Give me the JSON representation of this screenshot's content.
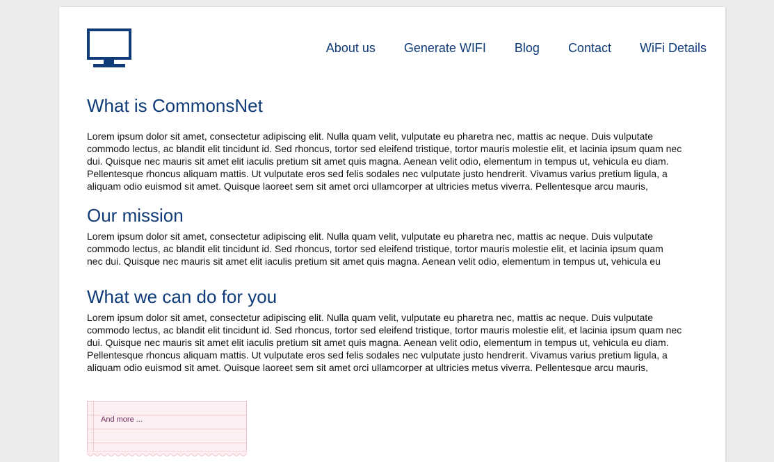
{
  "header": {
    "logo_icon": "monitor-icon",
    "nav": [
      {
        "label": "About us"
      },
      {
        "label": "Generate WIFI"
      },
      {
        "label": "Blog"
      },
      {
        "label": "Contact"
      },
      {
        "label": "WiFi Details"
      }
    ]
  },
  "sections": [
    {
      "title": "What is CommonsNet",
      "body": "Lorem ipsum dolor sit amet, consectetur adipiscing elit. Nulla quam velit, vulputate eu pharetra nec, mattis ac neque. Duis vulputate commodo lectus, ac blandit elit tincidunt id. Sed rhoncus, tortor sed eleifend tristique, tortor mauris molestie elit, et lacinia ipsum quam nec dui. Quisque nec mauris sit amet elit iaculis pretium sit amet quis magna. Aenean velit odio, elementum in tempus ut, vehicula eu diam. Pellentesque rhoncus aliquam mattis. Ut vulputate eros sed felis sodales nec vulputate justo hendrerit. Vivamus varius pretium ligula, a aliquam odio euismod sit amet. Quisque laoreet sem sit amet orci ullamcorper at ultricies metus viverra. Pellentesque arcu mauris,"
    },
    {
      "title": "Our mission",
      "body": "Lorem ipsum dolor sit amet, consectetur adipiscing elit. Nulla quam velit, vulputate eu pharetra nec, mattis ac neque. Duis vulputate commodo lectus, ac blandit elit tincidunt id. Sed rhoncus, tortor sed eleifend tristique, tortor mauris molestie elit, et lacinia ipsum quam nec dui. Quisque nec mauris sit amet elit iaculis pretium sit amet quis magna. Aenean velit odio, elementum in tempus ut, vehicula eu"
    },
    {
      "title": "What we can do for you",
      "body": "Lorem ipsum dolor sit amet, consectetur adipiscing elit. Nulla quam velit, vulputate eu pharetra nec, mattis ac neque. Duis vulputate commodo lectus, ac blandit elit tincidunt id. Sed rhoncus, tortor sed eleifend tristique, tortor mauris molestie elit, et lacinia ipsum quam nec dui. Quisque nec mauris sit amet elit iaculis pretium sit amet quis magna. Aenean velit odio, elementum in tempus ut, vehicula eu diam. Pellentesque rhoncus aliquam mattis. Ut vulputate eros sed felis sodales nec vulputate justo hendrerit. Vivamus varius pretium ligula, a aliquam odio euismod sit amet. Quisque laoreet sem sit amet orci ullamcorper at ultricies metus viverra. Pellentesque arcu mauris,"
    }
  ],
  "note": {
    "label": "And more ..."
  },
  "colors": {
    "brand": "#0f3b78",
    "background": "#ececec",
    "note_paper": "#fdf0f3",
    "note_lines": "#f1cbd4"
  }
}
